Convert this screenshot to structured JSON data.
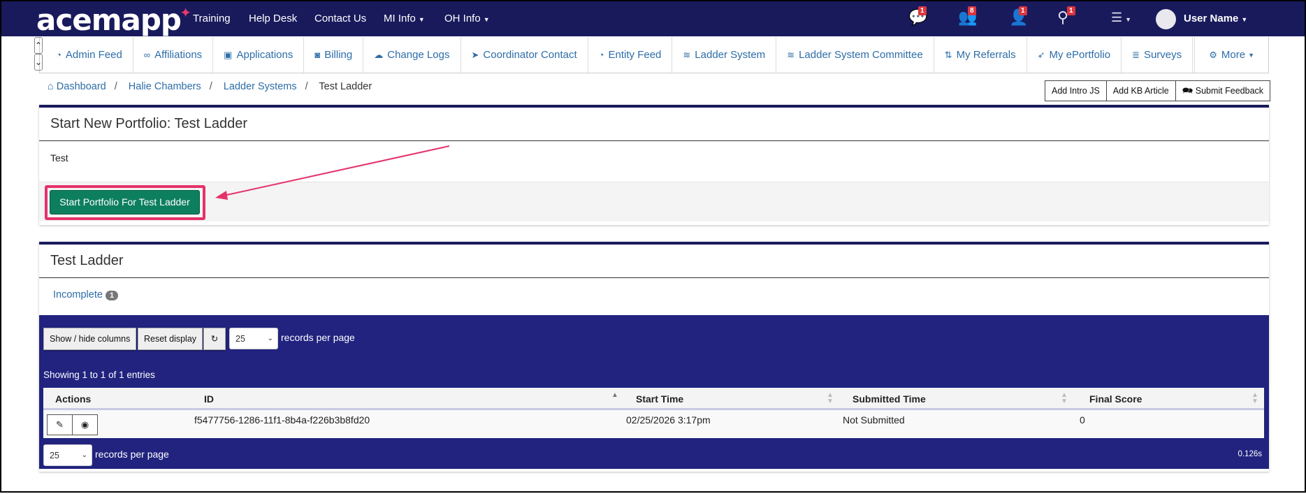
{
  "topnav": {
    "logo": "acemapp",
    "items": [
      "Training",
      "Help Desk",
      "Contact Us",
      "MI Info",
      "OH Info"
    ],
    "icons": [
      {
        "name": "messages-icon",
        "badge": "1"
      },
      {
        "name": "users-icon",
        "badge": "8"
      },
      {
        "name": "user-icon",
        "badge": "1"
      },
      {
        "name": "network-icon",
        "badge": "1"
      },
      {
        "name": "menu-icon",
        "badge": ""
      }
    ],
    "user": "User Name"
  },
  "subnav": {
    "items": [
      {
        "label": "Admin Feed",
        "icon": "rss-icon"
      },
      {
        "label": "Affiliations",
        "icon": "link-icon"
      },
      {
        "label": "Applications",
        "icon": "id-card-icon"
      },
      {
        "label": "Billing",
        "icon": "money-icon"
      },
      {
        "label": "Change Logs",
        "icon": "cloud-icon"
      },
      {
        "label": "Coordinator Contact",
        "icon": "paper-plane-icon"
      },
      {
        "label": "Entity Feed",
        "icon": "rss-icon"
      },
      {
        "label": "Ladder System",
        "icon": "pool-icon"
      },
      {
        "label": "Ladder System Committee",
        "icon": "pool-icon"
      },
      {
        "label": "My Referrals",
        "icon": "retweet-icon"
      },
      {
        "label": "My ePortfolio",
        "icon": "rocket-icon"
      },
      {
        "label": "Surveys",
        "icon": "list-icon"
      },
      {
        "label": "More",
        "icon": "gear-icon"
      }
    ]
  },
  "breadcrumb": [
    "Dashboard",
    "Halie Chambers",
    "Ladder Systems",
    "Test Ladder"
  ],
  "actions": [
    "Add Intro JS",
    "Add KB Article",
    "Submit Feedback"
  ],
  "panel1": {
    "title": "Start New Portfolio: Test Ladder",
    "body": "Test",
    "button": "Start Portfolio For Test Ladder"
  },
  "panel2": {
    "title": "Test Ladder",
    "tab": "Incomplete",
    "tab_count": "1",
    "controls": {
      "show_hide": "Show / hide columns",
      "reset": "Reset display",
      "page_size": "25",
      "records_per_page": "records per page"
    },
    "info": "Showing 1 to 1 of 1 entries",
    "columns": [
      "Actions",
      "ID",
      "Start Time",
      "Submitted Time",
      "Final Score"
    ],
    "rows": [
      {
        "id": "f5477756-1286-11f1-8b4a-f226b3b8fd20",
        "start": "02/25/2026 3:17pm",
        "submitted": "Not Submitted",
        "score": "0"
      }
    ],
    "timing": "0.126s"
  },
  "colors": {
    "navbar": "#191a5c",
    "table_bg": "#21237f",
    "start_button": "#0d7f5f",
    "highlight": "#e5326a"
  }
}
